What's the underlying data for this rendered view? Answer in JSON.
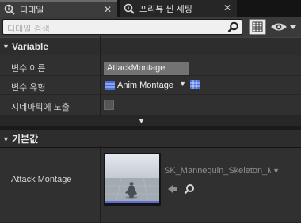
{
  "tabs": [
    {
      "label": "디테일",
      "icon": "details-icon",
      "close": "✕"
    },
    {
      "label": "프리뷰 씬 세팅",
      "icon": "details-icon",
      "close": "✕"
    }
  ],
  "search": {
    "placeholder": "디테일 검색"
  },
  "sections": {
    "variable": {
      "title": "Variable",
      "caret": "▼"
    },
    "defaults": {
      "title": "기본값",
      "caret": "▼"
    }
  },
  "variable": {
    "name_label": "변수 이름",
    "name_value": "AttackMontage",
    "type_label": "변수 유형",
    "type_value": "Anim Montage",
    "type_arrow": "▼",
    "expose_label": "시네마틱에 노출",
    "expose_checked": false
  },
  "collapse_arrow": "▼",
  "defaults": {
    "attack_label": "Attack Montage",
    "asset_value": "SK_Mannequin_Skeleton_Montage",
    "asset_arrow": "▼"
  },
  "colors": {
    "pin_blue": "#4a6fd8",
    "panel": "#303030",
    "header": "#2d2d2d"
  }
}
